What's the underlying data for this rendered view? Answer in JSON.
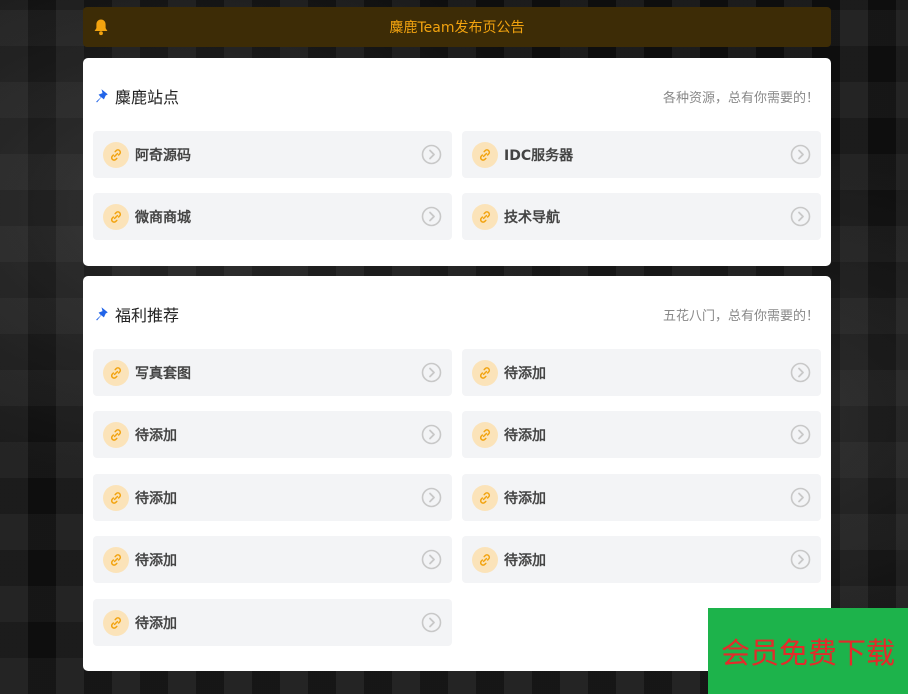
{
  "notice": {
    "text": "麋鹿Team发布页公告"
  },
  "sections": [
    {
      "title": "麋鹿站点",
      "subtitle": "各种资源，总有你需要的！",
      "items": [
        "阿奇源码",
        "IDC服务器",
        "微商商城",
        "技术导航"
      ]
    },
    {
      "title": "福利推荐",
      "subtitle": "五花八门，总有你需要的！",
      "items": [
        "写真套图",
        "待添加",
        "待添加",
        "待添加",
        "待添加",
        "待添加",
        "待添加",
        "待添加",
        "待添加"
      ]
    }
  ],
  "download": {
    "label": "会员免费下载"
  },
  "colors": {
    "notice_bg": "#3d2c06",
    "notice_text": "#f2a30f",
    "link_icon": "#f2a30f",
    "pin_icon": "#2264e8",
    "download_bg": "#1db34b",
    "download_text": "#e32b2b"
  }
}
